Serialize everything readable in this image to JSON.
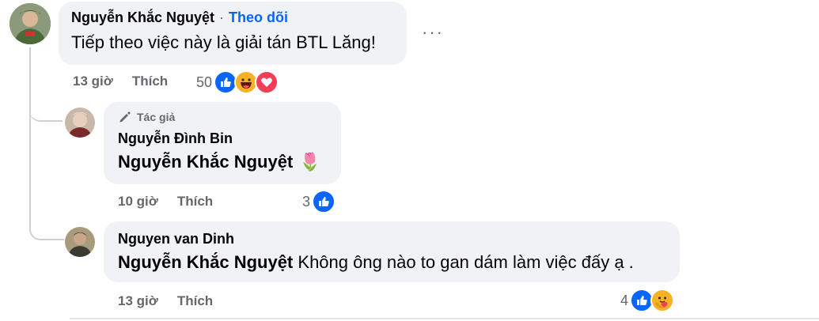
{
  "comments": [
    {
      "author": "Nguyễn Khắc Nguyệt",
      "follow_label": "Theo dõi",
      "text": "Tiếp theo việc này là giải tán BTL Lăng!",
      "time": "13 giờ",
      "like_label": "Thích",
      "reaction_count": "50",
      "more_label": "···",
      "reactions": [
        "like-icon",
        "haha-icon",
        "love-icon"
      ]
    },
    {
      "badge": "Tác giả",
      "author": "Nguyễn Đình Bin",
      "mention": "Nguyễn Khắc Nguyệt",
      "emoji": "🌷",
      "time": "10 giờ",
      "like_label": "Thích",
      "reaction_count": "3",
      "reactions": [
        "like-icon"
      ]
    },
    {
      "author": "Nguyen van Dinh",
      "mention": "Nguyễn Khắc Nguyệt",
      "text": "Không ông nào to gan dám làm việc đấy ạ .",
      "time": "13 giờ",
      "like_label": "Thích",
      "reaction_count": "4",
      "reactions": [
        "like-icon",
        "care-icon"
      ]
    }
  ],
  "colors": {
    "bubble": "#f0f2f5",
    "link": "#0866ff",
    "meta": "#65676b",
    "like": "#0866ff",
    "love": "#f33e58",
    "haha": "#f7b125"
  }
}
